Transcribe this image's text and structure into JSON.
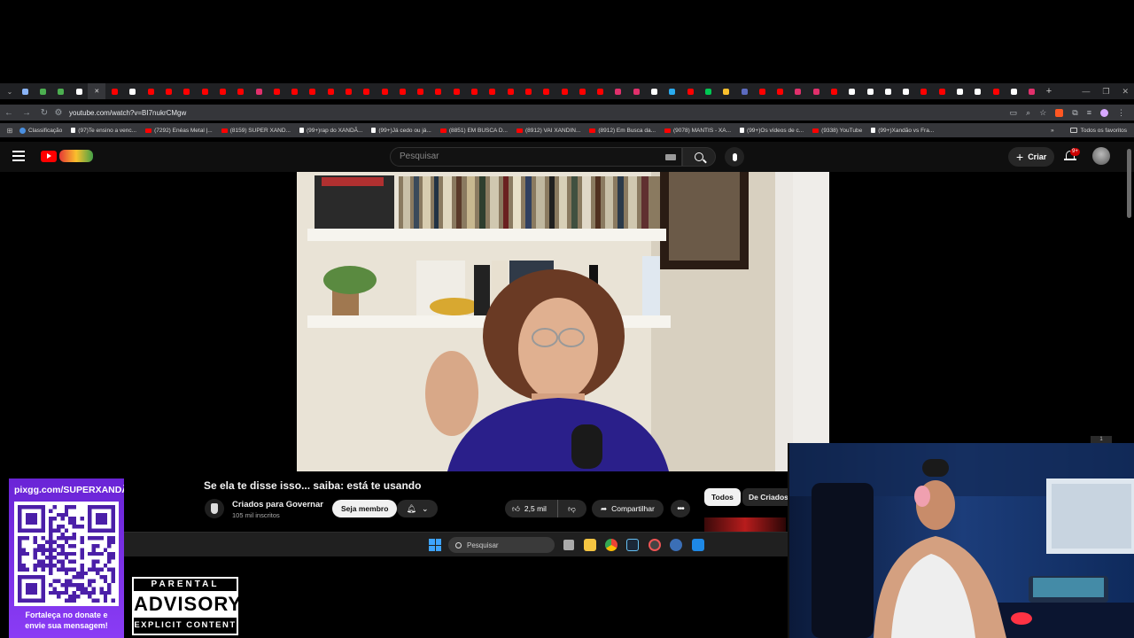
{
  "browser": {
    "url": "youtube.com/watch?v=BI7nukrCMgw",
    "tab_colors": [
      "#8ab4f8",
      "#4caf50",
      "#4caf50",
      "#ffffff",
      "#ff0000",
      "#ff0000",
      "#ffffff",
      "#ff0000",
      "#ff0000",
      "#ff0000",
      "#ff0000",
      "#ff0000",
      "#ff0000",
      "#e1306c",
      "#ff0000",
      "#ff0000",
      "#ff0000",
      "#ff0000",
      "#ff0000",
      "#ff0000",
      "#ff0000",
      "#ff0000",
      "#ff0000",
      "#ff0000",
      "#ff0000",
      "#ff0000",
      "#ff0000",
      "#ff0000",
      "#ff0000",
      "#ff0000",
      "#ff0000",
      "#ff0000",
      "#ff0000",
      "#e1306c",
      "#e1306c",
      "#ffffff",
      "#2aabee",
      "#ff0000",
      "#00c853",
      "#fbc02d",
      "#5c6bc0",
      "#ff0000",
      "#ff0000",
      "#e1306c",
      "#e1306c",
      "#ff0000",
      "#ffffff",
      "#ffffff",
      "#ffffff",
      "#ffffff",
      "#ff0000",
      "#ff0000",
      "#ffffff",
      "#ffffff",
      "#ff0000",
      "#ffffff",
      "#e1306c"
    ],
    "bookmarks": [
      {
        "label": "Classificação",
        "icon": "classificacao-icon"
      },
      {
        "label": "(97)Te ensino a venc...",
        "icon": "tiktok-icon"
      },
      {
        "label": "(7292) Enéas Metal |...",
        "icon": "youtube-icon"
      },
      {
        "label": "(8159) SUPER XAND...",
        "icon": "youtube-icon"
      },
      {
        "label": "(99+)rap do XANDÃ...",
        "icon": "tiktok-icon"
      },
      {
        "label": "(99+)Já cedo ou já...",
        "icon": "tiktok-icon"
      },
      {
        "label": "(8851) EM BUSCA D...",
        "icon": "youtube-icon"
      },
      {
        "label": "(8912) VAI XANDIN...",
        "icon": "youtube-icon"
      },
      {
        "label": "(8912) Em Busca da...",
        "icon": "youtube-icon"
      },
      {
        "label": "(9078) MANTIS - XA...",
        "icon": "youtube-icon"
      },
      {
        "label": "(99+)Os vídeos de c...",
        "icon": "tiktok-icon"
      },
      {
        "label": "(9338) YouTube",
        "icon": "youtube-icon"
      },
      {
        "label": "(99+)Xandão vs Fra...",
        "icon": "tiktok-icon"
      }
    ],
    "bookmarks_more": "»",
    "all_favorites": "Todos os favoritos"
  },
  "youtube": {
    "search_placeholder": "Pesquisar",
    "create_label": "Criar",
    "notif_count": "9+",
    "video_title": "Se ela te disse isso... saiba: está te usando",
    "channel_name": "Criados para Governar",
    "subscribers": "105 mil inscritos",
    "member_label": "Seja membro",
    "likes": "2,5 mil",
    "share_label": "Compartilhar",
    "more_label": "•••",
    "chips": [
      "Todos",
      "De Criados"
    ]
  },
  "taskbar": {
    "search_placeholder": "Pesquisar"
  },
  "overlay": {
    "donate_url": "pixgg.com/SUPERXANDÃ",
    "donate_message": "Fortaleça no donate e\nenvie sua mensagem!",
    "advisory_top": "PARENTAL",
    "advisory_mid": "ADVISORY",
    "advisory_bottom": "EXPLICIT CONTENT",
    "webcam_corner": "1"
  },
  "colors": {
    "youtube_red": "#ff0000",
    "donate_purple": "#7b2ff2",
    "yt_bg": "#0f0f0f"
  }
}
